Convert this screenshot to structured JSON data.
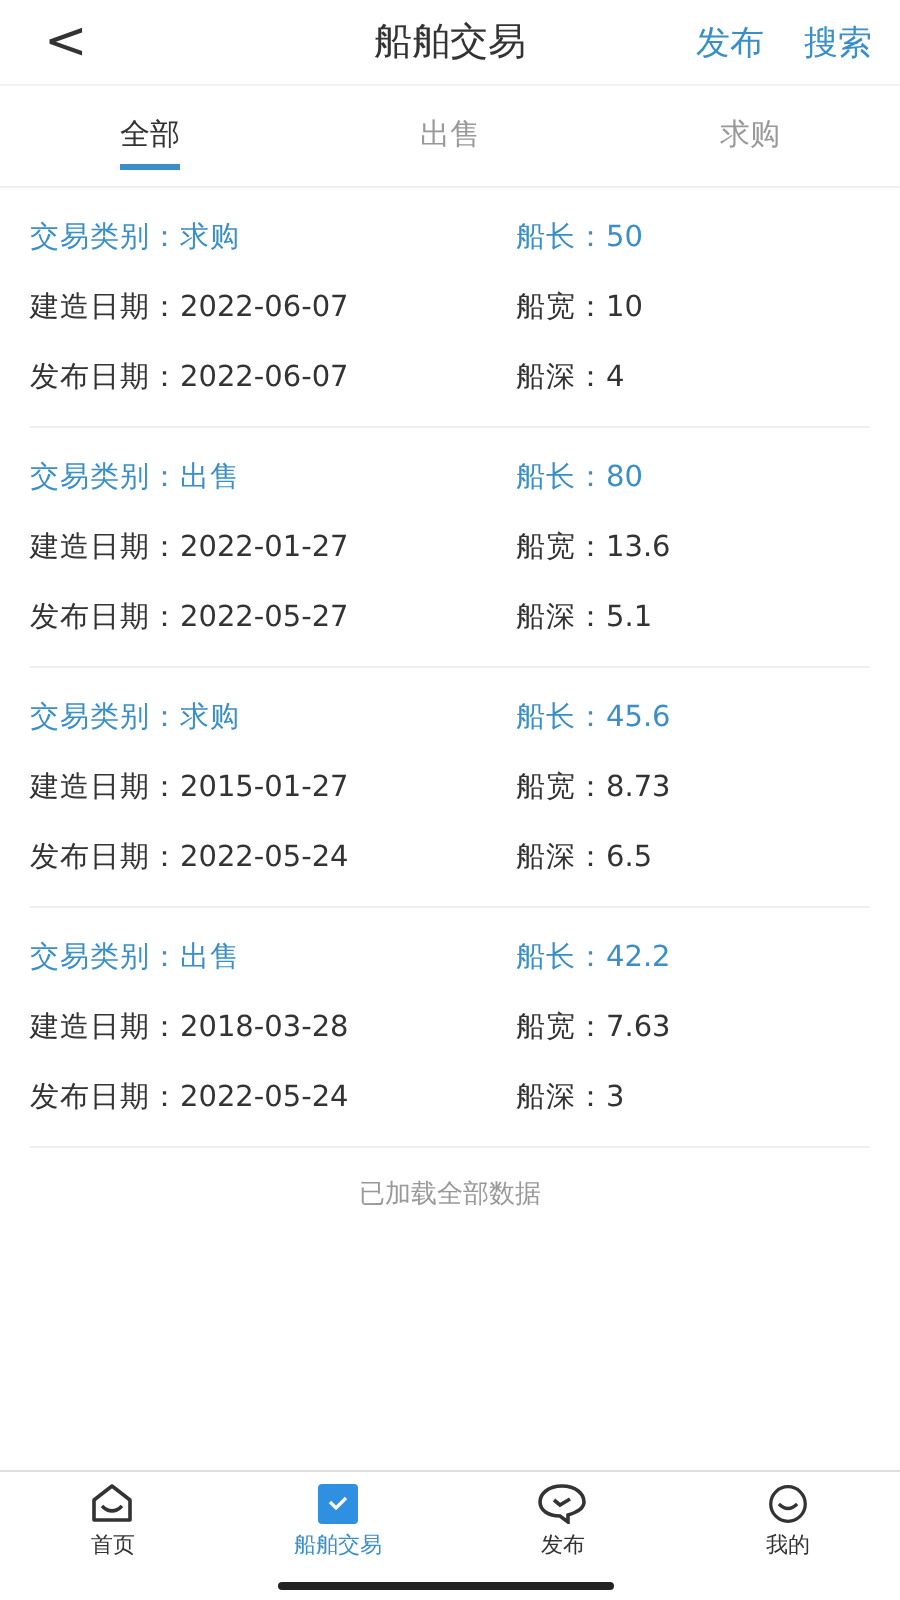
{
  "header": {
    "back": "<",
    "title": "船舶交易",
    "actions": [
      "发布",
      "搜索"
    ]
  },
  "tabs": [
    {
      "label": "全部",
      "selected": true
    },
    {
      "label": "出售",
      "selected": false
    },
    {
      "label": "求购",
      "selected": false
    }
  ],
  "listings": [
    {
      "trade_type": "交易类别：求购",
      "length": "船长：50",
      "build_date": "建造日期：2022-06-07",
      "width": "船宽：10",
      "publish_date": "发布日期：2022-06-07",
      "depth": "船深：4"
    },
    {
      "trade_type": "交易类别：出售",
      "length": "船长：80",
      "build_date": "建造日期：2022-01-27",
      "width": "船宽：13.6",
      "publish_date": "发布日期：2022-05-27",
      "depth": "船深：5.1"
    },
    {
      "trade_type": "交易类别：求购",
      "length": "船长：45.6",
      "build_date": "建造日期：2015-01-27",
      "width": "船宽：8.73",
      "publish_date": "发布日期：2022-05-24",
      "depth": "船深：6.5"
    },
    {
      "trade_type": "交易类别：出售",
      "length": "船长：42.2",
      "build_date": "建造日期：2018-03-28",
      "width": "船宽：7.63",
      "publish_date": "发布日期：2022-05-24",
      "depth": "船深：3"
    }
  ],
  "footer_note": "已加载全部数据",
  "bottom_nav": [
    {
      "label": "首页",
      "kind": "home",
      "selected": false
    },
    {
      "label": "船舶交易",
      "kind": "trade",
      "selected": true
    },
    {
      "label": "发布",
      "kind": "publish",
      "selected": false
    },
    {
      "label": "我的",
      "kind": "me",
      "selected": false
    }
  ]
}
